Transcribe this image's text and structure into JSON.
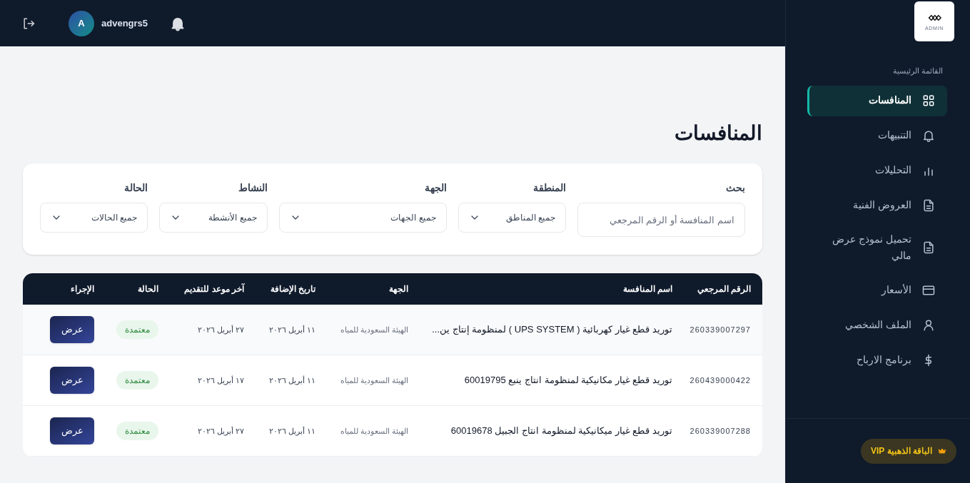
{
  "header": {
    "user_initial": "A",
    "username": "advengrs5"
  },
  "sidebar": {
    "logo_text": "ADMIN",
    "section_title": "القائمة الرئيسية",
    "items": [
      {
        "label": "المنافسات",
        "kind": "grid",
        "selected": true
      },
      {
        "label": "التنبيهات",
        "kind": "bell",
        "selected": false
      },
      {
        "label": "التحليلات",
        "kind": "chart",
        "selected": false
      },
      {
        "label": "العروض الفنية",
        "kind": "file",
        "selected": false
      },
      {
        "label": "تحميل نموذج عرض مالي",
        "kind": "file",
        "selected": false
      },
      {
        "label": "الأسعار",
        "kind": "card",
        "selected": false
      },
      {
        "label": "الملف الشخصي",
        "kind": "user",
        "selected": false
      },
      {
        "label": "برنامج الارباح",
        "kind": "dollar",
        "selected": false
      }
    ],
    "plan_badge": "الباقة الذهبية VIP"
  },
  "page_title": "المنافسات",
  "filters": {
    "search": {
      "label": "بحث",
      "placeholder": "اسم المنافسة أو الرقم المرجعي"
    },
    "selects": [
      {
        "label": "المنطقة",
        "value": "جميع المناطق"
      },
      {
        "label": "الجهة",
        "value": "جميع الجهات"
      },
      {
        "label": "النشاط",
        "value": "جميع الأنشطة"
      },
      {
        "label": "الحالة",
        "value": "جميع الحالات"
      }
    ]
  },
  "table": {
    "columns": [
      "الرقم المرجعي",
      "اسم المنافسة",
      "الجهة",
      "تاريخ الإضافة",
      "آخر موعد للتقديم",
      "الحالة",
      "الإجراء"
    ],
    "rows": [
      {
        "ref": "260339007297",
        "name": "توريد قطع غيار كهربائية ( UPS SYSTEM ) لمنظومة إنتاج ين...",
        "entity": "الهيئة السعودية للمياه",
        "added": "١١ أبريل ٢٠٢٦",
        "deadline": "٢٧ أبريل ٢٠٢٦",
        "status": "معتمدة",
        "action": "عرض"
      },
      {
        "ref": "260439000422",
        "name": "توريد قطع غيار مكانيكية لمنظومة انتاج ينبع 60019795",
        "entity": "الهيئة السعودية للمياه",
        "added": "١١ أبريل ٢٠٢٦",
        "deadline": "١٧ أبريل ٢٠٢٦",
        "status": "معتمدة",
        "action": "عرض"
      },
      {
        "ref": "260339007288",
        "name": "توريد قطع غيار ميكانيكية لمنظومة انتاج الجبيل 60019678",
        "entity": "الهيئة السعودية للمياه",
        "added": "١١ أبريل ٢٠٢٦",
        "deadline": "٢٧ أبريل ٢٠٢٦",
        "status": "معتمدة",
        "action": "عرض"
      }
    ]
  }
}
